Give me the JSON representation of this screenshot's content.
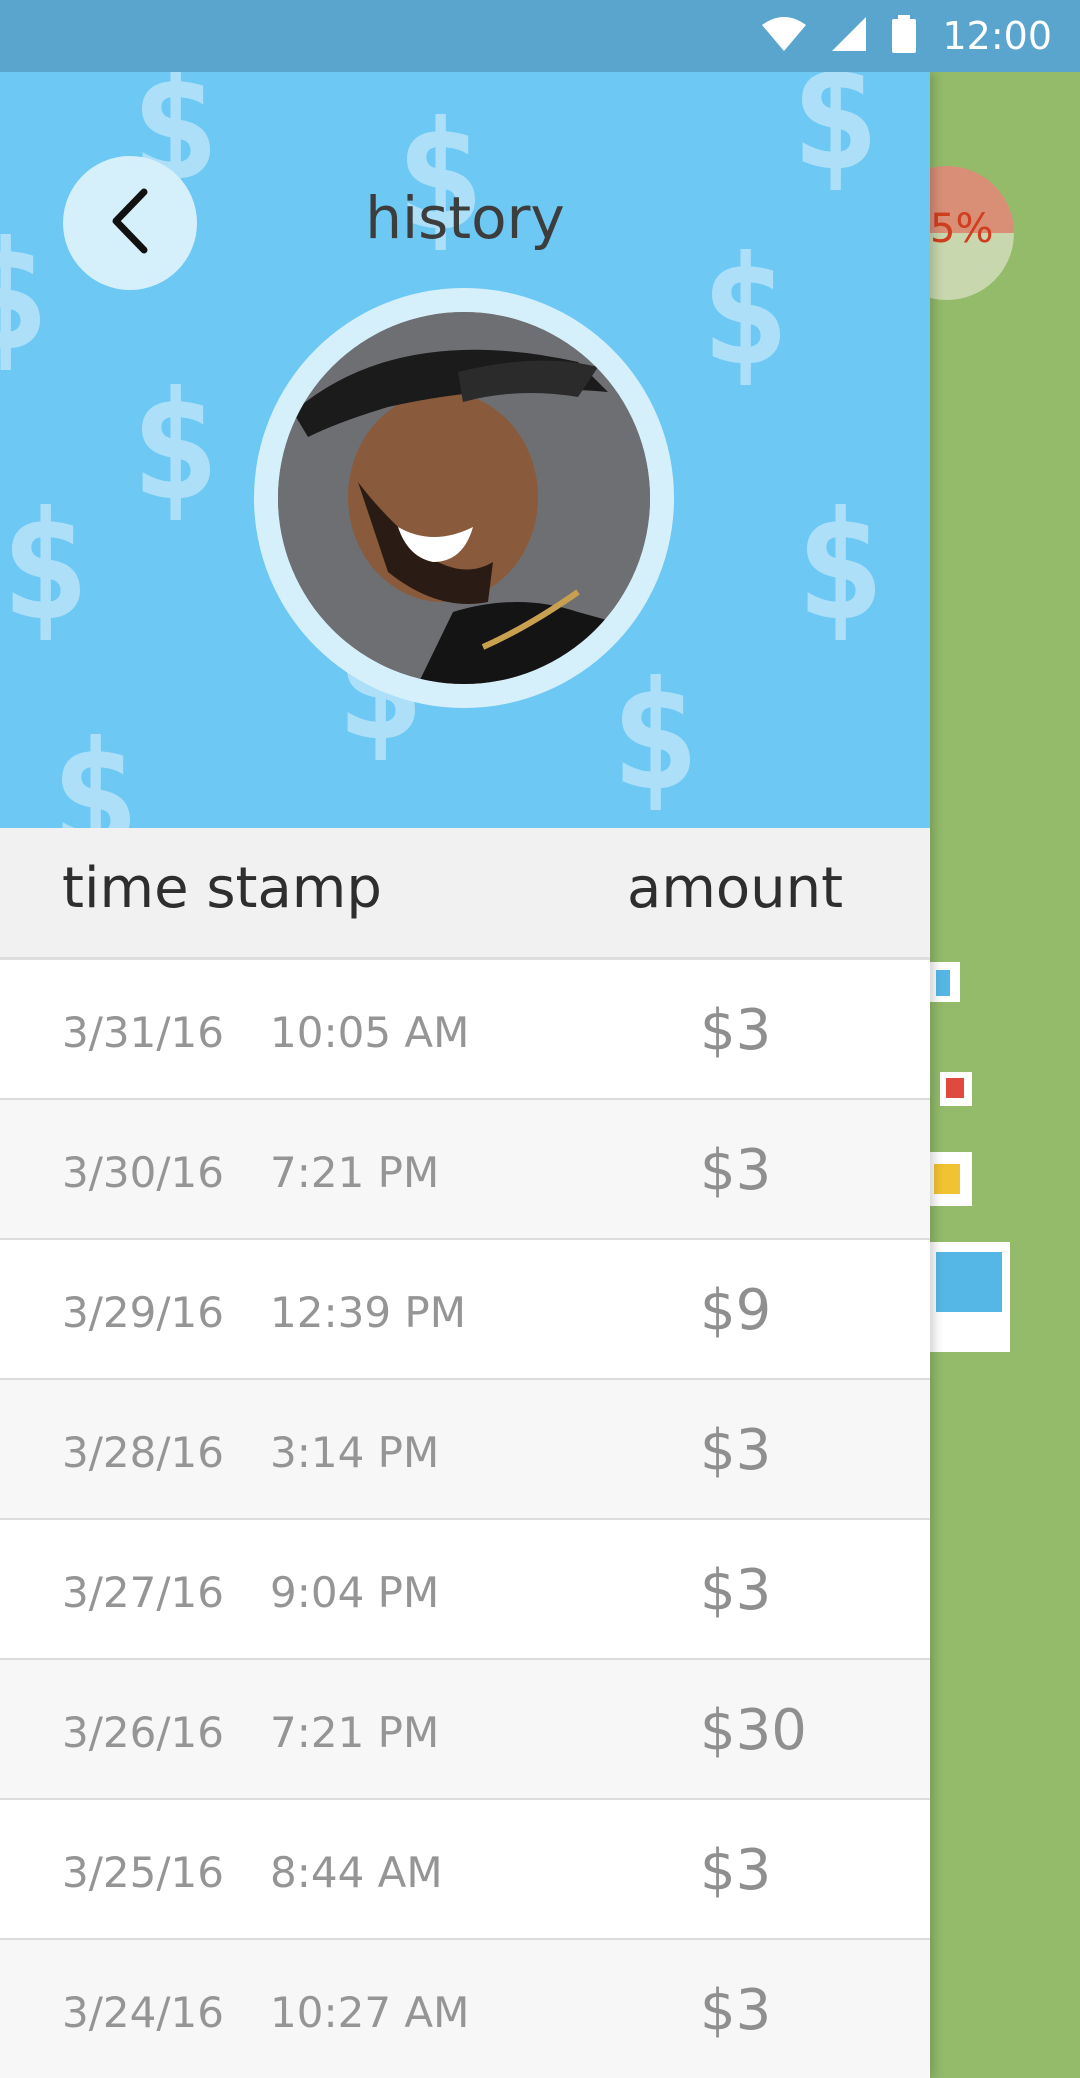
{
  "status_bar": {
    "time": "12:00",
    "icons": [
      "wifi-icon",
      "signal-icon",
      "battery-icon"
    ]
  },
  "background_app": {
    "percent_text": "5%"
  },
  "header": {
    "title": "history",
    "back_icon": "chevron-left-icon"
  },
  "table": {
    "columns": {
      "time_stamp": "time stamp",
      "amount": "amount"
    },
    "rows": [
      {
        "date": "3/31/16",
        "time": "10:05 AM",
        "amount": "$3"
      },
      {
        "date": "3/30/16",
        "time": "7:21 PM",
        "amount": "$3"
      },
      {
        "date": "3/29/16",
        "time": "12:39 PM",
        "amount": "$9"
      },
      {
        "date": "3/28/16",
        "time": "3:14 PM",
        "amount": "$3"
      },
      {
        "date": "3/27/16",
        "time": "9:04 PM",
        "amount": "$3"
      },
      {
        "date": "3/26/16",
        "time": "7:21 PM",
        "amount": "$30"
      },
      {
        "date": "3/25/16",
        "time": "8:44 AM",
        "amount": "$3"
      },
      {
        "date": "3/24/16",
        "time": "10:27 AM",
        "amount": "$3"
      }
    ]
  },
  "colors": {
    "status_bar": "#59a5cd",
    "header_bg": "#6dc8f3",
    "side_panel": "#93bb6a",
    "text_dark": "#3d3d3d",
    "text_muted": "#959595"
  }
}
